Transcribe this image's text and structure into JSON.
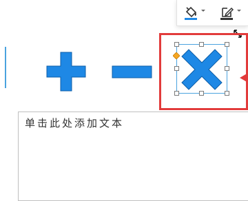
{
  "toolbar": {
    "fill_button": {
      "icon": "fill-bucket-icon",
      "accent_color": "#1e88e5"
    },
    "outline_button": {
      "icon": "pen-outline-icon",
      "accent_color": "#333333"
    },
    "dropdown_icon": "chevron-down-icon"
  },
  "canvas": {
    "shapes": [
      {
        "name": "plus-shape",
        "type": "plus",
        "fill": "#1e88e5"
      },
      {
        "name": "minus-shape",
        "type": "minus",
        "fill": "#1e88e5"
      },
      {
        "name": "multiply-shape",
        "type": "multiply",
        "fill": "#1e88e5",
        "selected": true
      }
    ],
    "selection_highlight_color": "#e23b3b",
    "selection_frame_color": "#4aa3df",
    "adjustment_handle_color": "#f5a623",
    "pointer_arrow_color": "#e23b3b"
  },
  "textbox": {
    "placeholder": "单击此处添加文本"
  }
}
